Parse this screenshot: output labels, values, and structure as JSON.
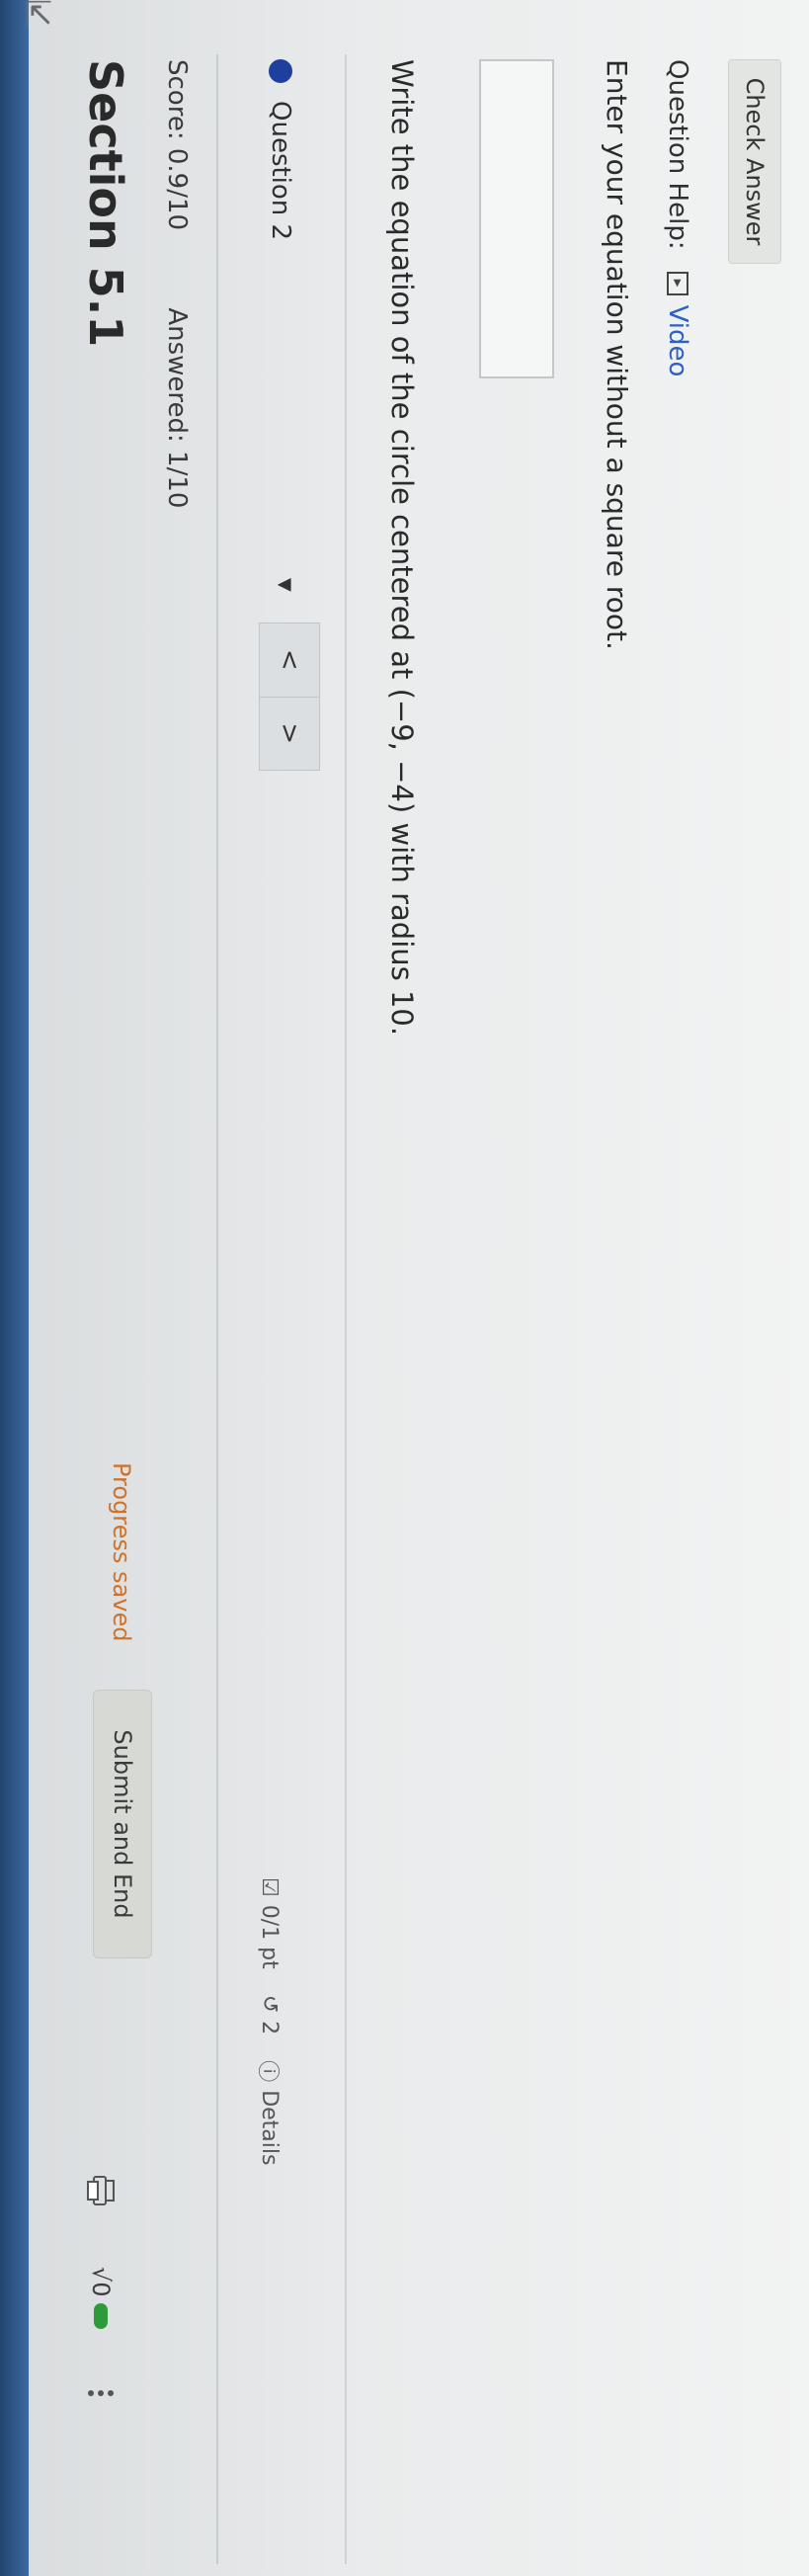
{
  "header": {
    "section_title": "Section 5.1",
    "score": "Score: 0.9/10",
    "answered": "Answered: 1/10",
    "progress_status": "Progress saved",
    "submit_label": "Submit and End",
    "sqrt_label": "√0"
  },
  "question_nav": {
    "current": "Question 2",
    "prev_label": "<",
    "next_label": ">",
    "points": "0/1 pt",
    "retries": "2",
    "details": "Details"
  },
  "question": {
    "prompt": "Write the equation of the circle centered at (−9, −4) with radius 10.",
    "answer_value": "",
    "instruction": "Enter your equation without a square root.",
    "help_label": "Question Help:",
    "video_label": "Video",
    "check_label": "Check Answer"
  },
  "colors": {
    "progress_text": "#d0732a",
    "link_blue": "#2c5fc7",
    "question_dot": "#1f3f9e",
    "edge_blue": "#22456f"
  },
  "icons": [
    "cursor-icon",
    "print-icon",
    "sqrt-icon",
    "menu-dots-icon",
    "checkbox-icon",
    "retry-icon",
    "details-icon",
    "video-icon",
    "chevron-down-icon"
  ]
}
